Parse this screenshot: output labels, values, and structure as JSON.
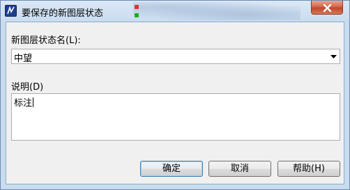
{
  "window": {
    "title": "要保存的新图层状态",
    "close_symbol": "×"
  },
  "form": {
    "name_label": "新图层状态名(L):",
    "name_value": "中望",
    "description_label": "说明(D)",
    "description_value": "标注"
  },
  "buttons": {
    "ok": "确定",
    "cancel": "取消",
    "help": "帮助(H)"
  },
  "icons": {
    "app": "app-logo-icon",
    "close": "close-icon",
    "dropdown": "chevron-down-icon"
  }
}
